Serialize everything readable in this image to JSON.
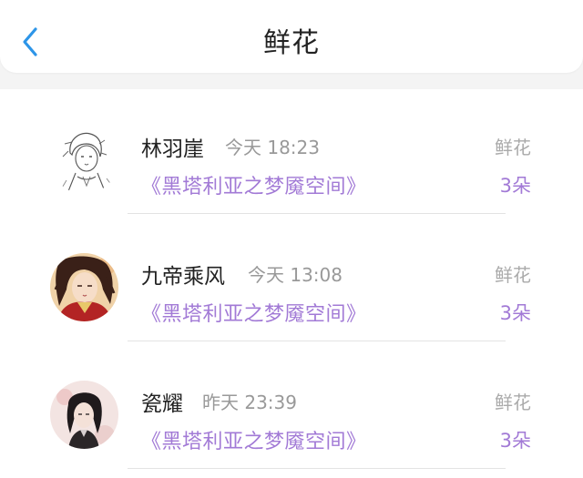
{
  "header": {
    "title": "鲜花",
    "back_icon": "chevron-left-icon",
    "accent_color": "#2d95e8"
  },
  "records": [
    {
      "name": "林羽崖",
      "time": "今天 18:23",
      "book": "《黑塔利亚之梦魇空间》",
      "gift_type": "鲜花",
      "gift_count": "3朵",
      "avatar": "sketch-portrait-avatar"
    },
    {
      "name": "九帝乘风",
      "time": "今天 13:08",
      "book": "《黑塔利亚之梦魇空间》",
      "gift_type": "鲜花",
      "gift_count": "3朵",
      "avatar": "red-robed-character-avatar"
    },
    {
      "name": "瓷耀",
      "time": "昨天 23:39",
      "book": "《黑塔利亚之梦魇空间》",
      "gift_type": "鲜花",
      "gift_count": "3朵",
      "avatar": "dark-haired-character-avatar"
    }
  ],
  "colors": {
    "book_link": "#a27ad6",
    "gift_count": "#a27ad6",
    "muted_text": "#999999"
  }
}
